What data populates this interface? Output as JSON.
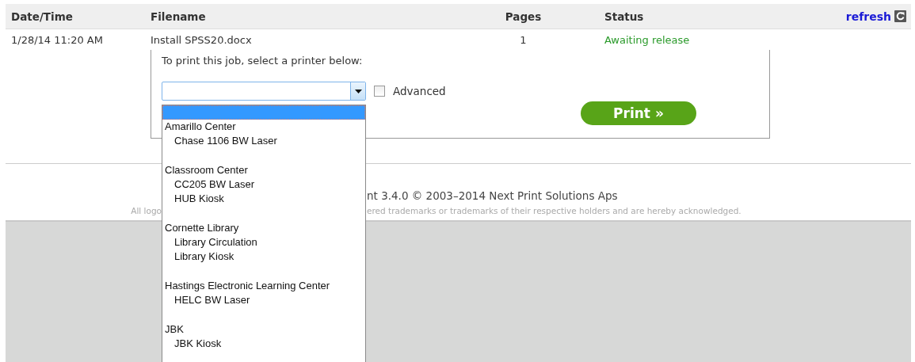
{
  "table": {
    "columns": [
      "Date/Time",
      "Filename",
      "Pages",
      "Status"
    ],
    "refresh_link": "refresh",
    "rows": [
      {
        "date_time": "1/28/14 11:20 AM",
        "filename": "Install SPSS20.docx",
        "pages": "1",
        "status": "Awaiting release"
      }
    ]
  },
  "print_panel": {
    "instruction": "To print this job, select a printer below:",
    "advanced": {
      "label": "Advanced",
      "checked": false
    },
    "print_button": "Print »",
    "printer_list": {
      "blank_option_selected": true,
      "groups": [
        {
          "label": "Amarillo Center",
          "children": [
            {
              "label": "Chase 1106 BW Laser",
              "selected": false
            }
          ]
        },
        {
          "label": "Classroom Center",
          "children": [
            {
              "label": "CC205 BW Laser",
              "selected": false
            },
            {
              "label": "HUB Kiosk",
              "selected": false
            }
          ]
        },
        {
          "label": "Cornette Library",
          "children": [
            {
              "label": "Library Circulation",
              "selected": false
            },
            {
              "label": "Library Kiosk",
              "selected": false
            }
          ]
        },
        {
          "label": "Hastings Electronic Learning Center",
          "children": [
            {
              "label": "HELC BW Laser",
              "selected": false
            }
          ]
        },
        {
          "label": "JBK",
          "children": [
            {
              "label": "JBK Kiosk",
              "selected": false
            }
          ]
        }
      ]
    }
  },
  "footer": {
    "line_1_visible": "nt 3.4.0 © 2003–2014 Next Print Solutions Aps",
    "line_2_left": "All logo",
    "line_2_right": "ered trademarks or trademarks of their respective holders and are hereby acknowledged."
  }
}
